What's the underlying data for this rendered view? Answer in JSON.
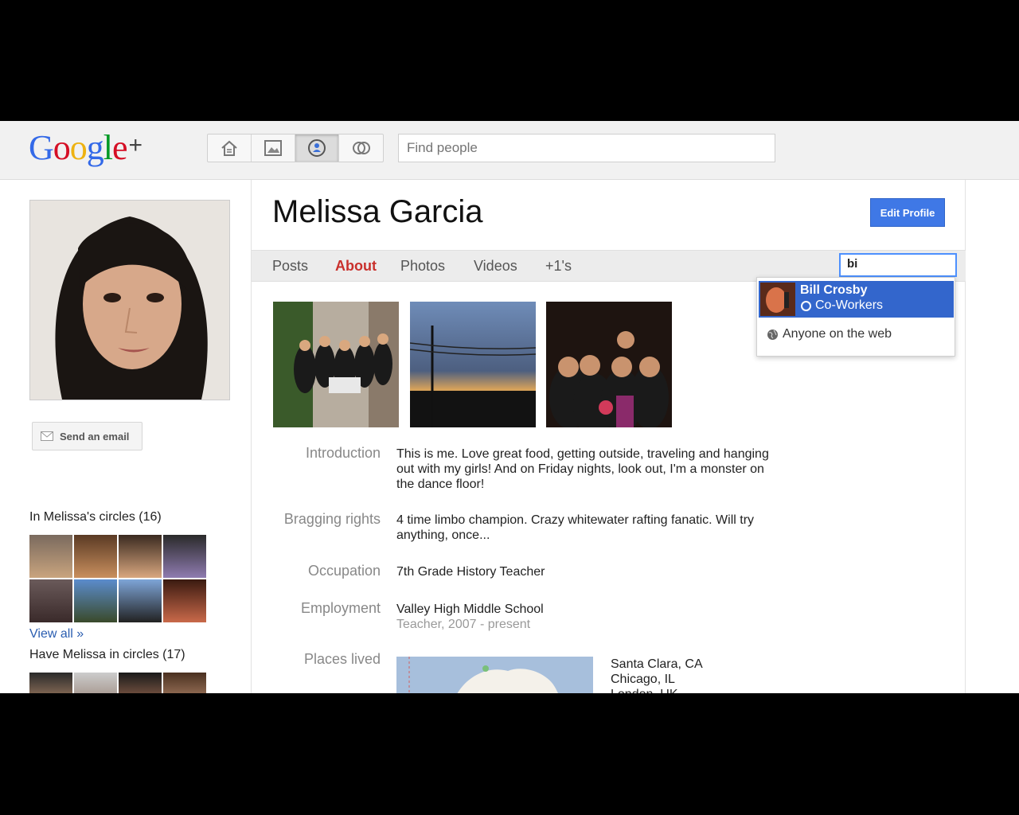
{
  "header": {
    "logo_word": "Google",
    "logo_plus": "+",
    "nav_icons": [
      "home-icon",
      "photos-icon",
      "profile-icon",
      "circles-icon"
    ],
    "search_placeholder": "Find people"
  },
  "sidebar": {
    "email_button": "Send an email",
    "in_circles_label": "In Melissa's circles (16)",
    "view_all": "View all »",
    "have_in_circles_label": "Have Melissa in circles (17)"
  },
  "profile": {
    "name": "Melissa Garcia",
    "edit_button": "Edit Profile",
    "tabs": [
      "Posts",
      "About",
      "Photos",
      "Videos",
      "+1's"
    ],
    "active_tab": "About",
    "circle_search_value": "bi",
    "suggestion": {
      "name": "Bill Crosby",
      "circle": "Co-Workers"
    },
    "anyone_option": "Anyone on the web",
    "about": {
      "introduction_label": "Introduction",
      "introduction_text": "This is me. Love great food, getting outside, traveling and hanging out with my girls! And on Friday nights, look out, I'm a monster on the dance floor!",
      "bragging_label": "Bragging rights",
      "bragging_text": "4 time limbo champion. Crazy whitewater rafting fanatic. Will try anything, once...",
      "occupation_label": "Occupation",
      "occupation_text": "7th Grade History Teacher",
      "employment_label": "Employment",
      "employment_text": "Valley High Middle School",
      "employment_sub": "Teacher, 2007 - present",
      "places_label": "Places lived",
      "places": [
        "Santa Clara, CA",
        "Chicago, IL",
        "London, UK"
      ]
    }
  },
  "colors": {
    "accent_blue": "#3f78e6",
    "active_tab_red": "#c9302c",
    "link_blue": "#2a5db0",
    "suggestion_bg": "#3366cc"
  }
}
